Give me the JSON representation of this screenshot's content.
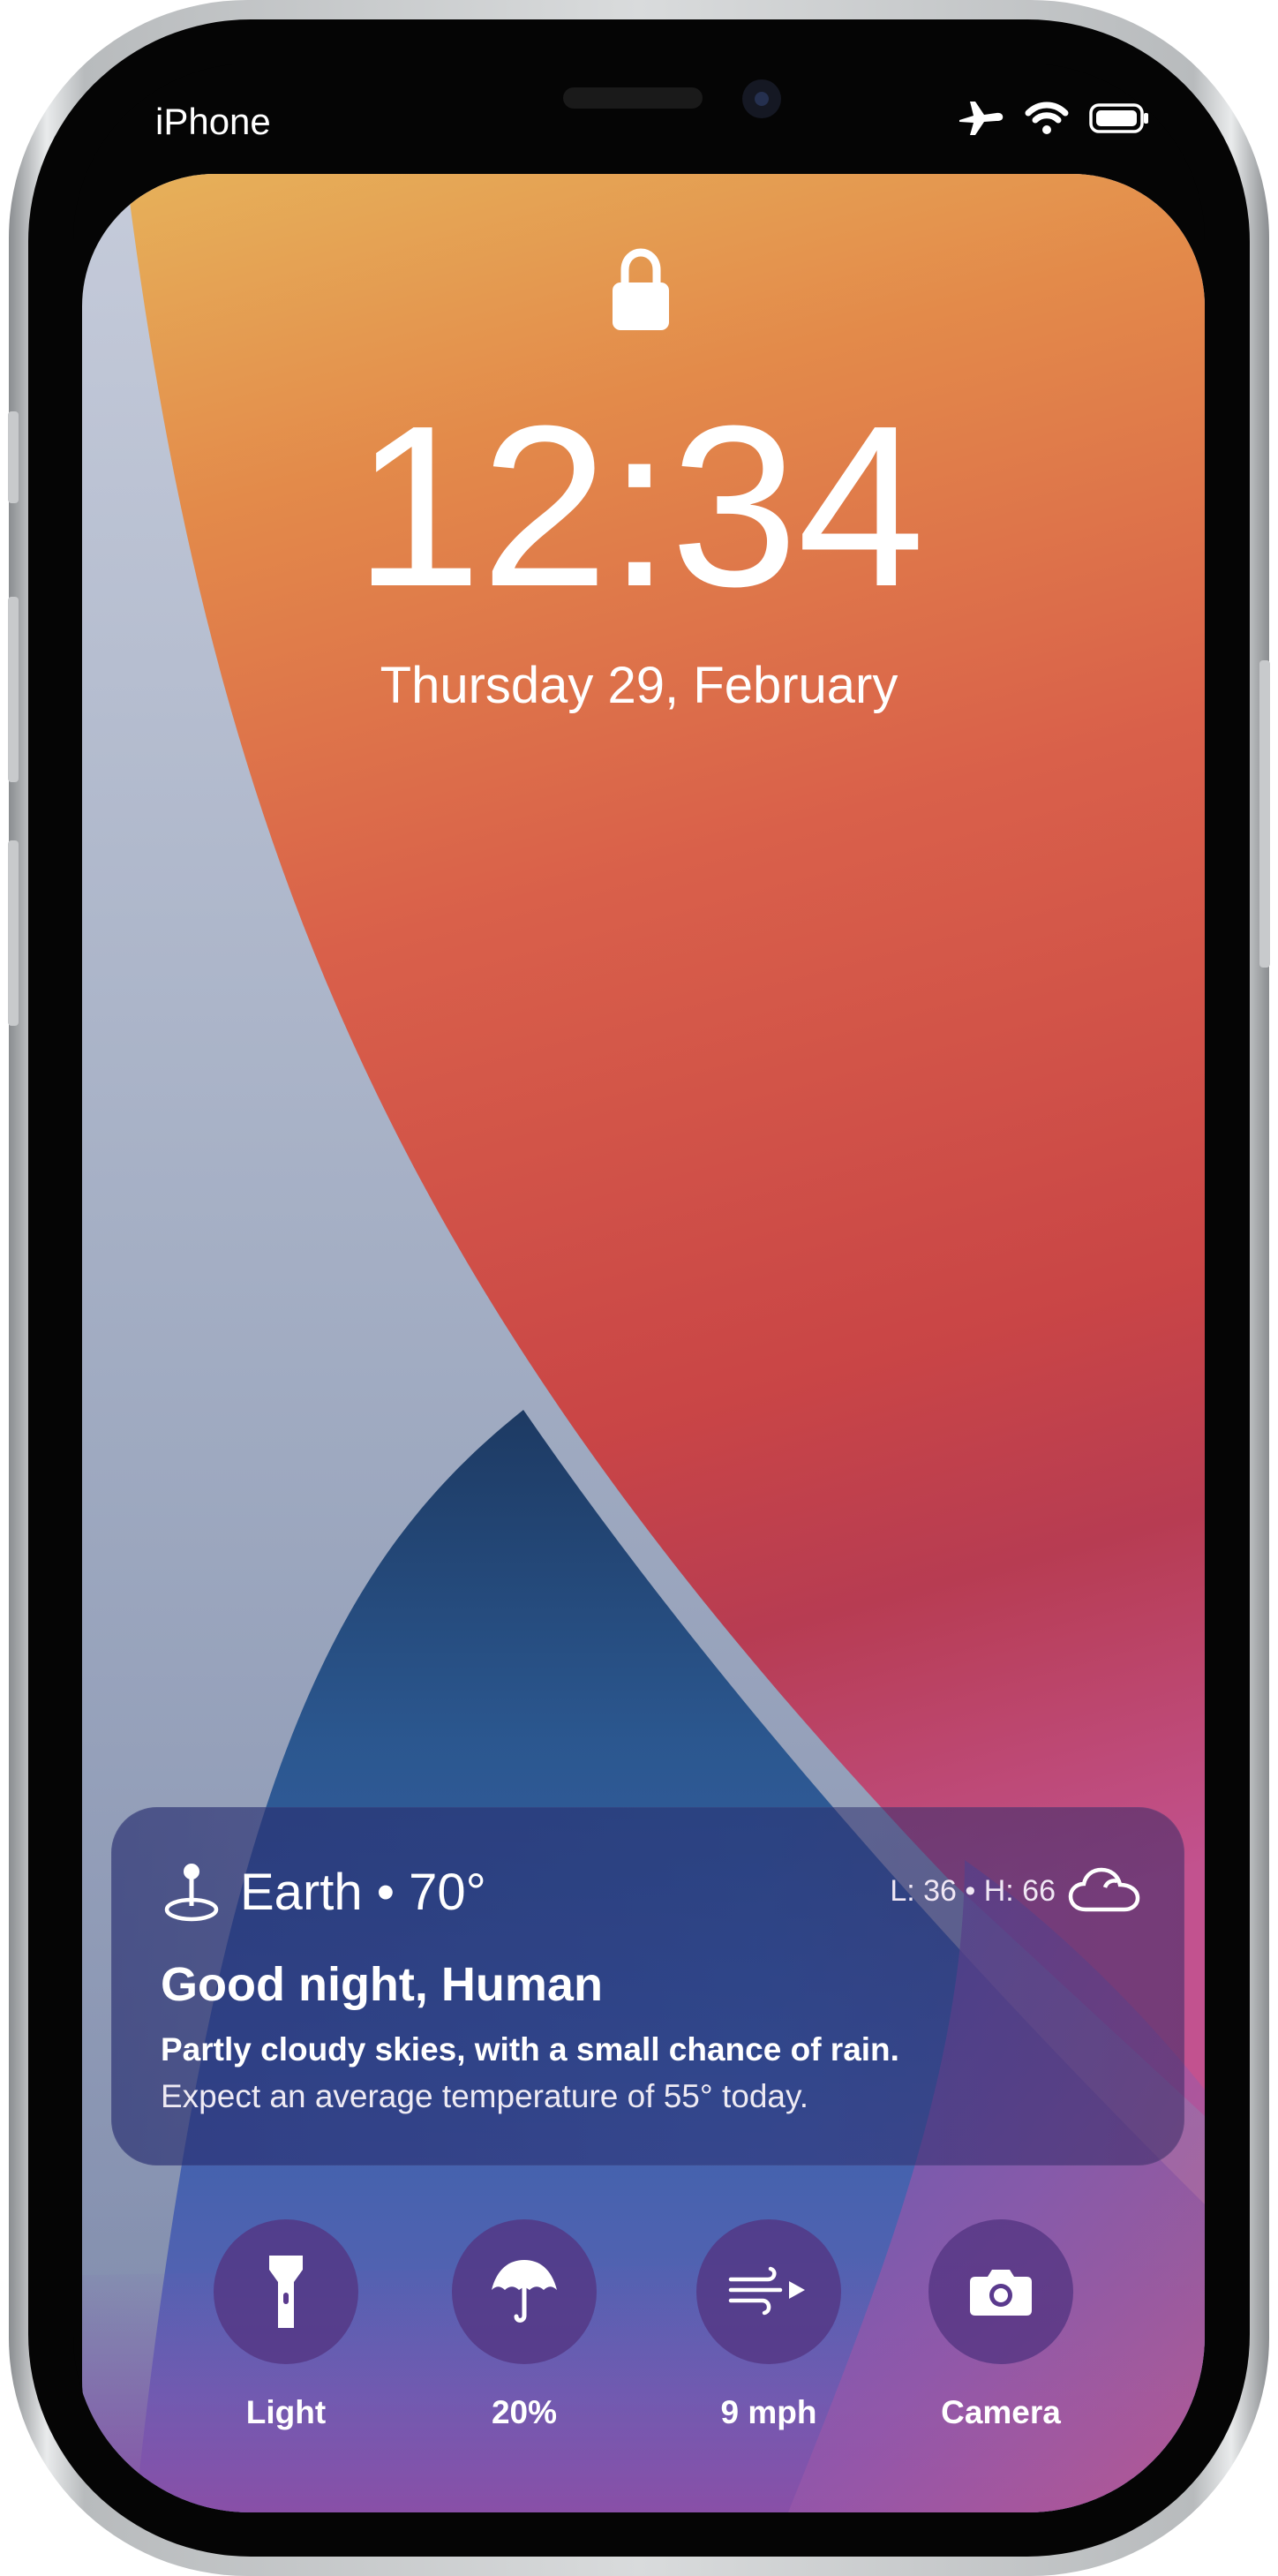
{
  "status_bar": {
    "carrier": "iPhone",
    "icons": [
      "airplane-mode-icon",
      "wifi-icon",
      "battery-icon"
    ]
  },
  "lock_screen": {
    "lock_icon": "lock-icon",
    "time": "12:34",
    "date": "Thursday 29, February"
  },
  "weather_widget": {
    "location_icon": "location-pin-icon",
    "location": "Earth • 70°",
    "range": "L: 36 • H: 66",
    "condition_icon": "cloud-icon",
    "greeting": "Good night, Human",
    "summary": "Partly cloudy skies, with a small chance of rain.",
    "detail": "Expect an average temperature of 55° today."
  },
  "shortcuts": [
    {
      "icon": "flashlight-icon",
      "label": "Light"
    },
    {
      "icon": "umbrella-icon",
      "label": "20%"
    },
    {
      "icon": "wind-icon",
      "label": "9 mph"
    },
    {
      "icon": "camera-icon",
      "label": "Camera"
    }
  ],
  "colors": {
    "wallpaper_orange": "#E4A05A",
    "wallpaper_red": "#C84A43",
    "wallpaper_blue": "#2E5C93",
    "wallpaper_purple": "#8A4BA4",
    "widget_tint": "#3F3F86"
  }
}
